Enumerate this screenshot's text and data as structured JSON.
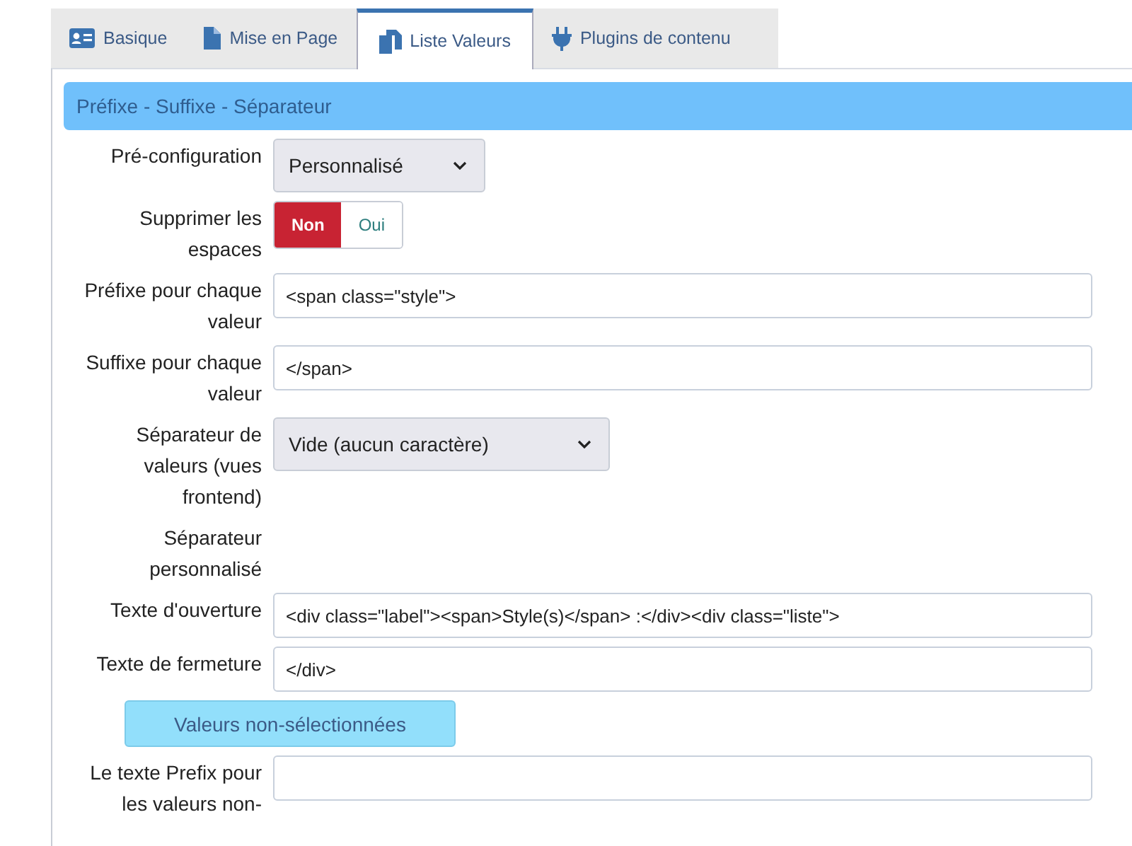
{
  "tabs": [
    {
      "label": "Basique",
      "selected": false
    },
    {
      "label": "Mise en Page",
      "selected": false
    },
    {
      "label": "Liste Valeurs",
      "selected": true
    },
    {
      "label": "Plugins de contenu",
      "selected": false
    }
  ],
  "section": {
    "title": "Préfixe - Suffixe - Séparateur"
  },
  "rows": [
    {
      "kind": "select",
      "label": "Pré-configuration",
      "value": "Personnalisé"
    },
    {
      "kind": "toggle",
      "label": "Supprimer les espaces",
      "options": [
        {
          "label": "Non",
          "selected": true
        },
        {
          "label": "Oui",
          "selected": false
        }
      ]
    },
    {
      "kind": "text",
      "label": "Préfixe pour chaque valeur",
      "value": "<span class=\"style\">"
    },
    {
      "kind": "text",
      "label": "Suffixe pour chaque valeur",
      "value": "</span>"
    },
    {
      "kind": "select",
      "label": "Séparateur de valeurs (vues frontend)",
      "value": "Vide (aucun caractère)"
    },
    {
      "kind": "empty",
      "label": "Séparateur personnalisé"
    },
    {
      "kind": "text",
      "label": "Texte d'ouverture",
      "value": "<div class=\"label\"><span>Style(s)</span> :</div><div class=\"liste\">"
    },
    {
      "kind": "text",
      "label": "Texte de fermeture",
      "value": "</div>"
    },
    {
      "kind": "button",
      "label": "Valeurs non-sélectionnées"
    },
    {
      "kind": "text",
      "label": "Le texte Prefix pour les valeurs non-"
    }
  ]
}
